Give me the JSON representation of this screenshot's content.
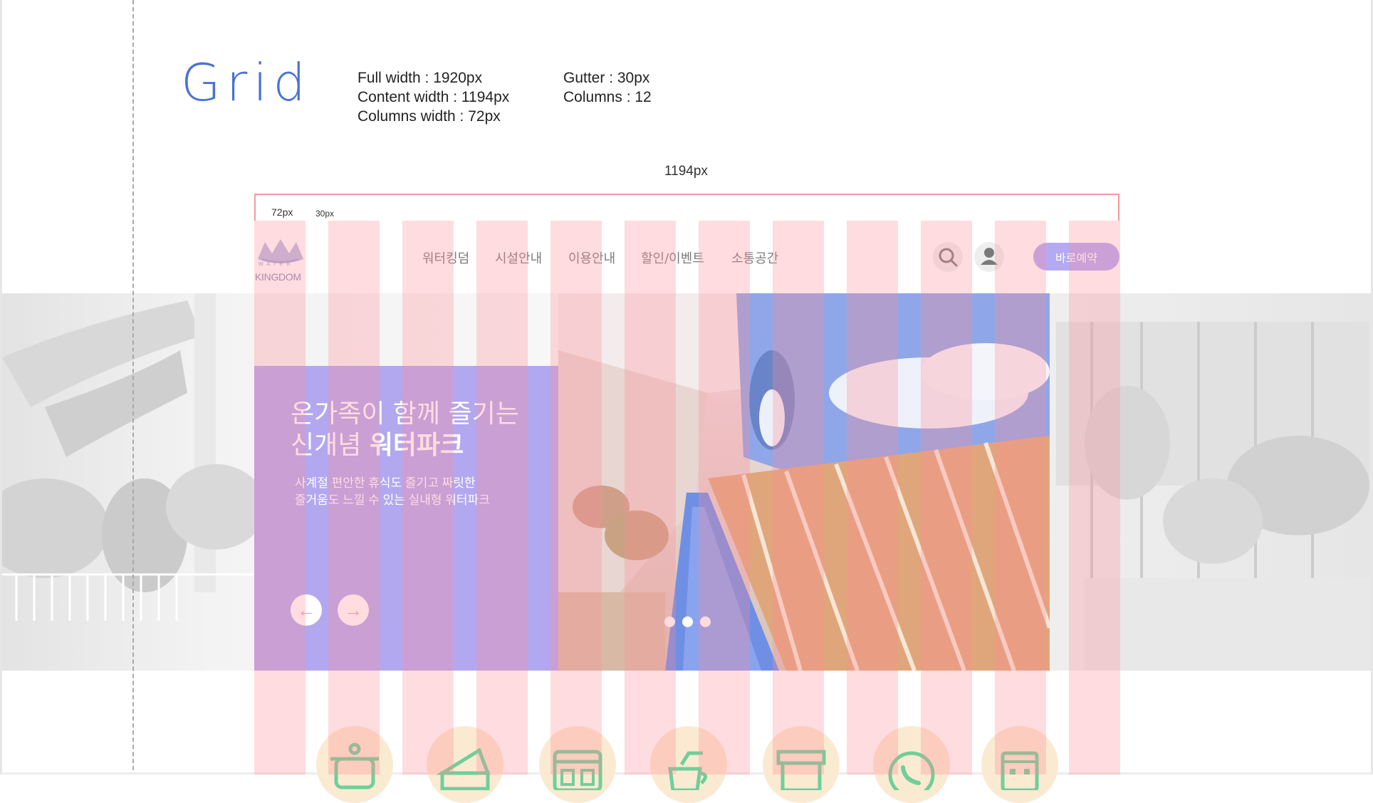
{
  "spec": {
    "title": "Grid",
    "full_width": "Full width : 1920px",
    "content_width": "Content width : 1194px",
    "columns_width": "Columns width : 72px",
    "gutter": "Gutter : 30px",
    "columns": "Columns : 12",
    "content_width_label": "1194px",
    "column_label": "72px",
    "gutter_label": "30px"
  },
  "nav": {
    "logo_water": "WATER",
    "logo_kingdom": "KINGDOM",
    "items": [
      "워터킹덤",
      "시설안내",
      "이용안내",
      "할인/이벤트",
      "소통공간"
    ],
    "book_label": "바로예약"
  },
  "hero": {
    "title_line1": "온가족이 함께 즐기는",
    "title_line2_plain": "신개념 ",
    "title_line2_bold": "워터파크",
    "desc_line1": "사계절 편안한 휴식도 즐기고 짜릿한",
    "desc_line2": "즐거움도 느낄 수 있는 실내형 워터파크",
    "prev_icon": "←",
    "next_icon": "→",
    "slide_count": 3,
    "active_slide": 1
  },
  "colors": {
    "accent": "#4a72d3",
    "panel": "#b2a8f0",
    "grid_overlay": "#ff8c96",
    "button": "#b3aaf2",
    "icon_bg": "#fbead2",
    "icon_stroke": "#6fcf9a"
  },
  "icons": [
    "pot-icon",
    "cheese-icon",
    "kiosk-icon",
    "coffee-icon",
    "shop-icon",
    "phone-icon",
    "building-icon"
  ]
}
